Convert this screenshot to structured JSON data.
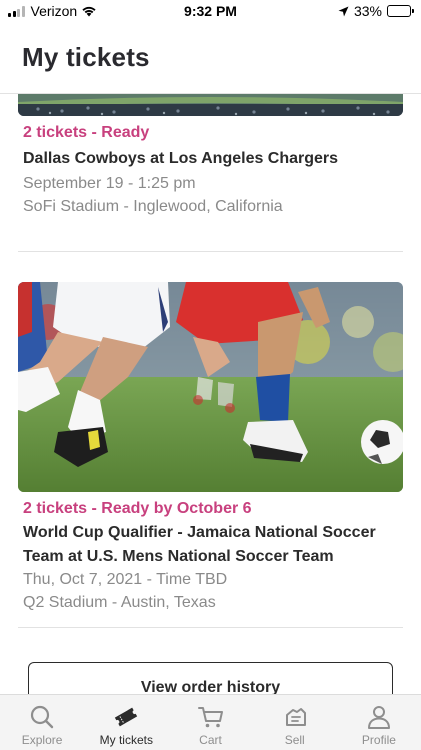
{
  "status_bar": {
    "carrier": "Verizon",
    "time": "9:32 PM",
    "battery_percent": "33%",
    "battery_level": 0.33
  },
  "header": {
    "title": "My tickets"
  },
  "tickets": [
    {
      "status": "2 tickets - Ready",
      "event": "Dallas Cowboys at Los Angeles Chargers",
      "date": "September 19 - 1:25 pm",
      "venue": "SoFi Stadium - Inglewood, California"
    },
    {
      "status": "2 tickets - Ready by October 6",
      "event": "World Cup Qualifier - Jamaica National Soccer Team at U.S. Mens National Soccer Team",
      "date": "Thu, Oct 7, 2021 - Time TBD",
      "venue": "Q2 Stadium - Austin, Texas"
    }
  ],
  "actions": {
    "view_history": "View order history"
  },
  "tab_bar": {
    "items": [
      {
        "label": "Explore",
        "icon": "search-icon"
      },
      {
        "label": "My tickets",
        "icon": "ticket-icon"
      },
      {
        "label": "Cart",
        "icon": "cart-icon"
      },
      {
        "label": "Sell",
        "icon": "sell-icon"
      },
      {
        "label": "Profile",
        "icon": "profile-icon"
      }
    ],
    "active": "My tickets"
  },
  "colors": {
    "accent": "#c8407e",
    "text": "#2b2b2b",
    "muted": "#8a8a8a"
  }
}
